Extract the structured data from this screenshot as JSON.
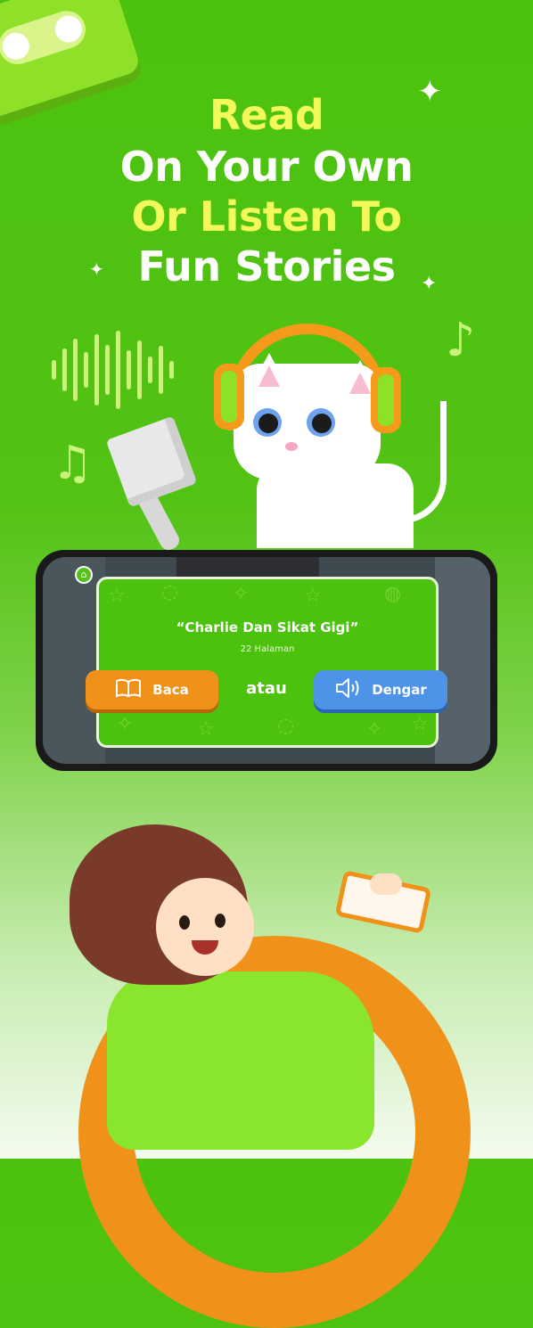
{
  "headline": {
    "line1": "Read",
    "line2": "On Your Own",
    "line3": "Or Listen To",
    "line4": "Fun Stories"
  },
  "story": {
    "title": "“Charlie Dan Sikat Gigi”",
    "pages": "22 Halaman"
  },
  "actions": {
    "read_label": "Baca",
    "or_label": "atau",
    "listen_label": "Dengar"
  },
  "icons": {
    "home": "home-icon",
    "read": "book-icon",
    "listen": "speaker-icon",
    "note": "music-note-icon",
    "sparkle": "sparkle-icon"
  },
  "colors": {
    "background": "#4cc20e",
    "highlight_text": "#f3f95a",
    "read_button": "#f0921a",
    "listen_button": "#4d94e8"
  }
}
